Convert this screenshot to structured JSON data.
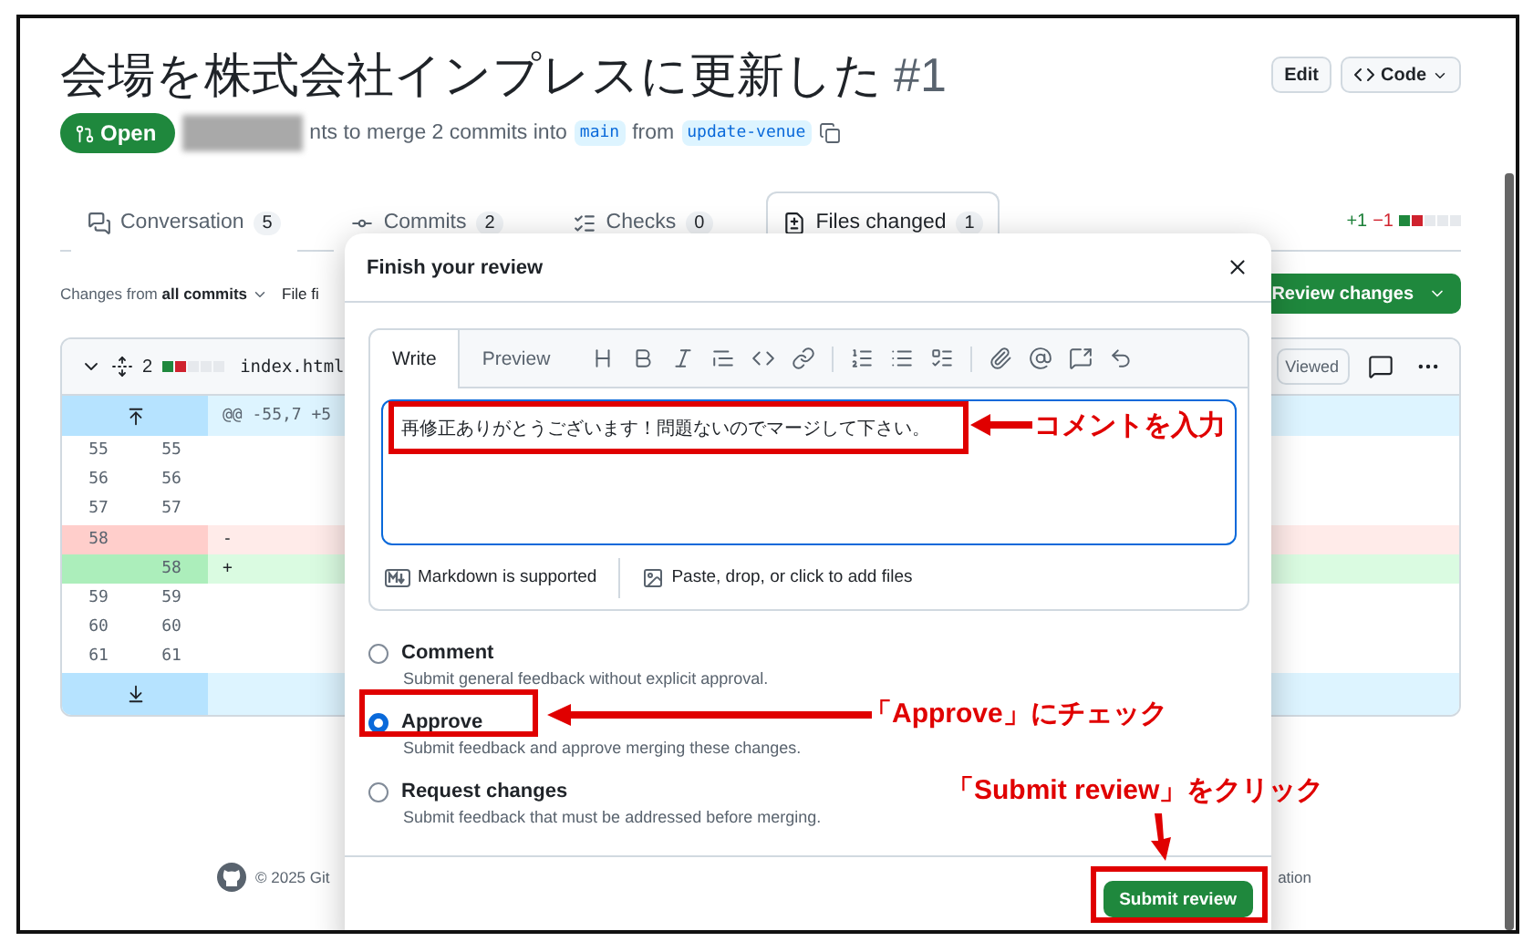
{
  "pull_request": {
    "title": "会場を株式会社インプレスに更新した",
    "number": "#1",
    "status": "Open",
    "summary": "nts to merge 2 commits into",
    "base_branch": "main",
    "from_label": "from",
    "head_branch": "update-venue"
  },
  "header_buttons": [
    "Edit",
    "Code"
  ],
  "tabs": [
    {
      "label": "Conversation",
      "count": "5",
      "selected": false
    },
    {
      "label": "Commits",
      "count": "2",
      "selected": false
    },
    {
      "label": "Checks",
      "count": "0",
      "selected": false
    },
    {
      "label": "Files changed",
      "count": "1",
      "selected": true
    }
  ],
  "diffstat": {
    "additions": "+1",
    "deletions": "−1"
  },
  "toolbar": {
    "changes_from": "Changes from",
    "changes_value": "all commits",
    "file_filter": "File fi",
    "review_button": "Review changes"
  },
  "file": {
    "changes": "2",
    "name": "index.html",
    "viewed": "Viewed",
    "hunk_header": "@@ -55,7 +5",
    "lines": [
      {
        "kind": "context",
        "old": "55",
        "new": "55"
      },
      {
        "kind": "context",
        "old": "56",
        "new": "56"
      },
      {
        "kind": "context",
        "old": "57",
        "new": "57"
      },
      {
        "kind": "deletion",
        "old": "58",
        "sign": "-"
      },
      {
        "kind": "addition",
        "new": "58",
        "sign": "+"
      },
      {
        "kind": "context",
        "old": "59",
        "new": "59"
      },
      {
        "kind": "context",
        "old": "60",
        "new": "60"
      },
      {
        "kind": "context",
        "old": "61",
        "new": "61"
      }
    ]
  },
  "footer": {
    "copyright": "© 2025 Git",
    "right_text": "ation"
  },
  "review_dialog": {
    "title": "Finish your review",
    "tabs": [
      {
        "label": "Write",
        "selected": true
      },
      {
        "label": "Preview",
        "selected": false
      }
    ],
    "comment": "再修正ありがとうございます！問題ないのでマージして下さい。",
    "markdown_note": "Markdown is supported",
    "attach_note": "Paste, drop, or click to add files",
    "options": [
      {
        "label": "Comment",
        "description": "Submit general feedback without explicit approval.",
        "selected": false
      },
      {
        "label": "Approve",
        "description": "Submit feedback and approve merging these changes.",
        "selected": true
      },
      {
        "label": "Request changes",
        "description": "Submit feedback that must be addressed before merging.",
        "selected": false
      }
    ],
    "submit": "Submit review"
  },
  "annotations": [
    {
      "label": "コメントを入力"
    },
    {
      "label": "「Approve」にチェック"
    },
    {
      "label": "「Submit review」をクリック"
    }
  ]
}
